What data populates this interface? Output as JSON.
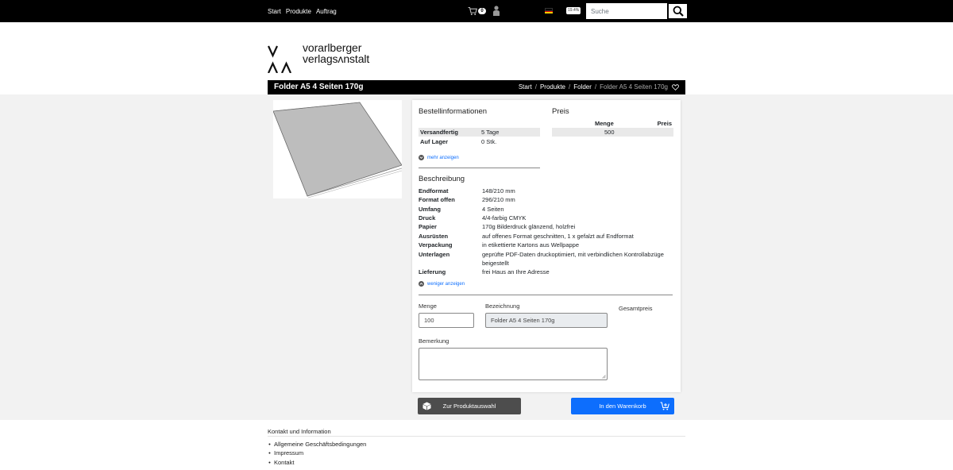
{
  "header": {
    "nav": [
      "Start",
      "Produkte",
      "Auftrag"
    ],
    "cart_count": "0",
    "pill_text": "19.4%",
    "search_placeholder": "Suche"
  },
  "logo": {
    "mark_top": "V",
    "mark_bottom": "Λ",
    "line1": "vorarlberger",
    "line2": "verlagsʌnstalt"
  },
  "title_bar": {
    "title": "Folder A5 4 Seiten 170g",
    "breadcrumb": [
      "Start",
      "Produkte",
      "Folder"
    ],
    "current": "Folder A5 4 Seiten 170g"
  },
  "order_info": {
    "heading": "Bestellinformationen",
    "rows": [
      {
        "key": "Versandfertig",
        "value": "5 Tage"
      },
      {
        "key": "Auf Lager",
        "value": "0 Stk."
      }
    ],
    "more_link": "mehr anzeigen"
  },
  "price": {
    "heading": "Preis",
    "col_menge": "Menge",
    "col_preis": "Preis",
    "row_menge": "500",
    "row_preis": ""
  },
  "description": {
    "heading": "Beschreibung",
    "rows": [
      {
        "key": "Endformat",
        "value": "148/210 mm"
      },
      {
        "key": "Format offen",
        "value": "296/210 mm"
      },
      {
        "key": "Umfang",
        "value": "4 Seiten"
      },
      {
        "key": "Druck",
        "value": "4/4-farbig CMYK"
      },
      {
        "key": "Papier",
        "value": "170g Bilderdruck glänzend, holzfrei"
      },
      {
        "key": "Ausrüsten",
        "value": "auf offenes Format geschnitten, 1 x gefalzt auf Endformat"
      },
      {
        "key": "Verpackung",
        "value": "in etikettierte Kartons aus Wellpappe"
      },
      {
        "key": "Unterlagen",
        "value": "geprüfte PDF-Daten druckoptimiert, mit verbindlichen Kontrollabzüge beigestellt"
      },
      {
        "key": "Lieferung",
        "value": "frei Haus an Ihre Adresse"
      }
    ],
    "less_link": "weniger anzeigen"
  },
  "form": {
    "menge_label": "Menge",
    "menge_value": "100",
    "bez_label": "Bezeichnung",
    "bez_value": "Folder A5 4 Seiten 170g",
    "gesamt_label": "Gesamtpreis",
    "bemerkung_label": "Bemerkung",
    "bemerkung_value": ""
  },
  "buttons": {
    "back": "Zur Produktauswahl",
    "cart": "In den Warenkorb"
  },
  "footer": {
    "heading": "Kontakt und Information",
    "links": [
      "Allgemeine Geschäftsbedingungen",
      "Impressum",
      "Kontakt"
    ]
  },
  "colors": {
    "topbar": "#000000",
    "accent_blue": "#0d6efd",
    "dark_button": "#4d4d4d",
    "page_gray": "#f2f2f2"
  },
  "icons": [
    "cart-icon",
    "user-icon",
    "flag-de-icon",
    "search-icon",
    "heart-icon",
    "chevron-down-icon",
    "chevron-up-icon",
    "box-icon",
    "cart-plus-icon",
    "resize-grip-icon"
  ]
}
